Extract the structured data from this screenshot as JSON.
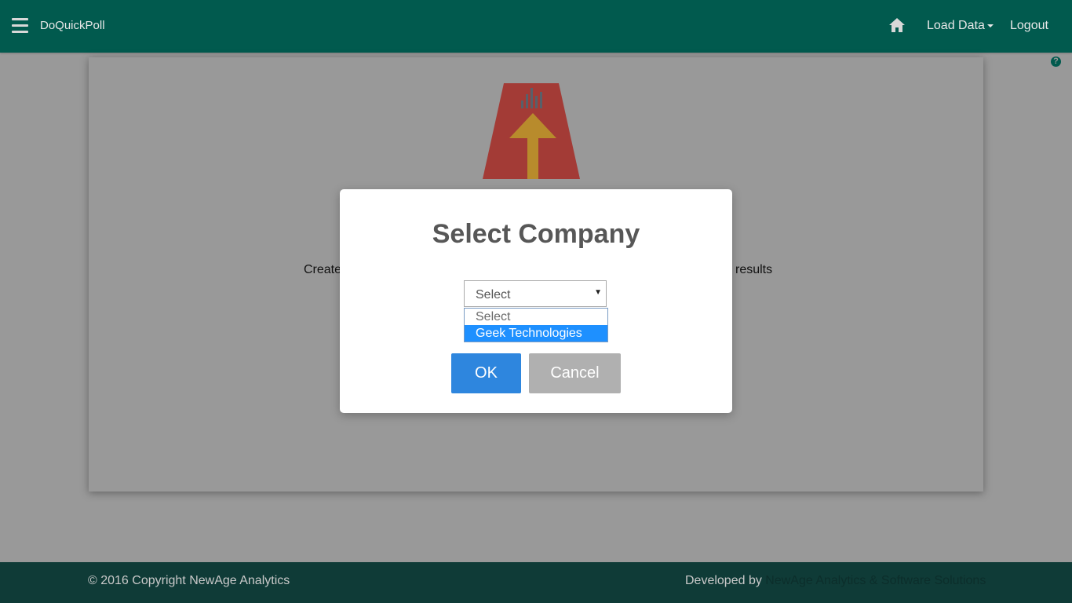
{
  "navbar": {
    "brand": "DoQuickPoll",
    "load_data_label": "Load Data",
    "logout_label": "Logout"
  },
  "hero": {
    "tagline_start": "Create,",
    "tagline_end": "results"
  },
  "modal": {
    "title": "Select Company",
    "select_value": "Select",
    "options": [
      "Select",
      "Geek Technologies"
    ],
    "highlighted_option": "Geek Technologies",
    "ok_label": "OK",
    "cancel_label": "Cancel"
  },
  "footer": {
    "copyright": "© 2016 Copyright NewAge Analytics",
    "developed_by_prefix": "Developed by",
    "developed_by_link": "NewAge Analytics & Software Solutions"
  },
  "colors": {
    "navbar_bg": "#015a4e",
    "footer_bg": "#0f3b37",
    "ok_button": "#2e86de",
    "cancel_button": "#b0b0b0",
    "option_highlight": "#1e90ff",
    "overlay": "#999999"
  },
  "icons": {
    "menu": "hamburger-icon",
    "home": "home-icon",
    "help": "question-circle-icon",
    "dropdown": "caret-down-icon"
  }
}
